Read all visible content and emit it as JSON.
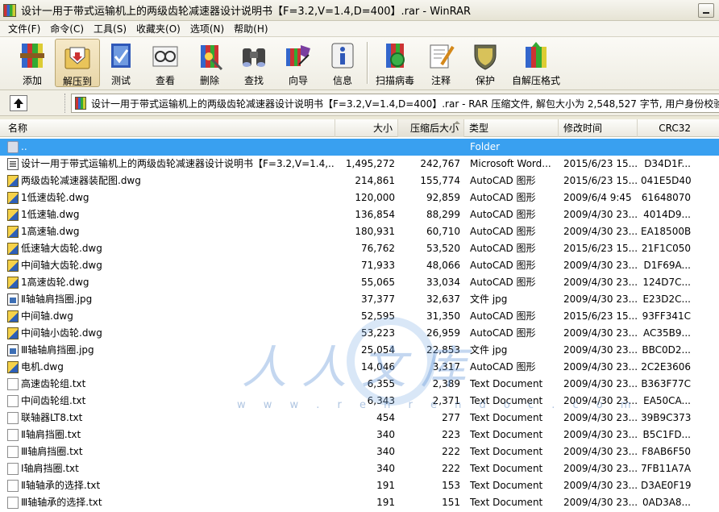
{
  "window": {
    "title": "设计一用于带式运输机上的两级齿轮减速器设计说明书【F=3.2,V=1.4,D=400】.rar - WinRAR"
  },
  "menu": [
    "文件(F)",
    "命令(C)",
    "工具(S)",
    "收藏夹(O)",
    "选项(N)",
    "帮助(H)"
  ],
  "toolbar": {
    "buttons": [
      {
        "label": "添加",
        "icon": "add-archive-icon"
      },
      {
        "label": "解压到",
        "icon": "extract-to-icon"
      },
      {
        "label": "测试",
        "icon": "test-icon"
      },
      {
        "label": "查看",
        "icon": "view-icon"
      },
      {
        "label": "删除",
        "icon": "delete-icon"
      },
      {
        "label": "查找",
        "icon": "find-binoculars-icon"
      },
      {
        "label": "向导",
        "icon": "wizard-icon"
      },
      {
        "label": "信息",
        "icon": "info-icon"
      },
      {
        "label": "扫描病毒",
        "icon": "virus-scan-icon"
      },
      {
        "label": "注释",
        "icon": "comment-icon"
      },
      {
        "label": "保护",
        "icon": "protect-shield-icon"
      },
      {
        "label": "自解压格式",
        "icon": "sfx-icon"
      }
    ]
  },
  "address": {
    "text": "设计一用于带式运输机上的两级齿轮减速器设计说明书【F=3.2,V=1.4,D=400】.rar - RAR 压缩文件, 解包大小为 2,548,527 字节, 用户身份校验信"
  },
  "columns": {
    "name": "名称",
    "size": "大小",
    "packed": "压缩后大小",
    "type": "类型",
    "modified": "修改时间",
    "crc": "CRC32"
  },
  "files": [
    {
      "name": "..",
      "size": "",
      "packed": "",
      "type": "Folder",
      "modified": "",
      "crc": "",
      "icon": "folder"
    },
    {
      "name": "设计一用于带式运输机上的两级齿轮减速器设计说明书【F=3.2,V=1.4,...",
      "size": "1,495,272",
      "packed": "242,767",
      "type": "Microsoft Word...",
      "modified": "2015/6/23 15...",
      "crc": "D34D1F...",
      "icon": "word"
    },
    {
      "name": "两级齿轮减速器装配图.dwg",
      "size": "214,861",
      "packed": "155,774",
      "type": "AutoCAD 图形",
      "modified": "2015/6/23 15...",
      "crc": "041E5D40",
      "icon": "dwg"
    },
    {
      "name": "1低速齿轮.dwg",
      "size": "120,000",
      "packed": "92,859",
      "type": "AutoCAD 图形",
      "modified": "2009/6/4 9:45",
      "crc": "61648070",
      "icon": "dwg"
    },
    {
      "name": "1低速轴.dwg",
      "size": "136,854",
      "packed": "88,299",
      "type": "AutoCAD 图形",
      "modified": "2009/4/30 23...",
      "crc": "4014D9...",
      "icon": "dwg"
    },
    {
      "name": "1高速轴.dwg",
      "size": "180,931",
      "packed": "60,710",
      "type": "AutoCAD 图形",
      "modified": "2009/4/30 23...",
      "crc": "EA18500B",
      "icon": "dwg"
    },
    {
      "name": "低速轴大齿轮.dwg",
      "size": "76,762",
      "packed": "53,520",
      "type": "AutoCAD 图形",
      "modified": "2015/6/23 15...",
      "crc": "21F1C050",
      "icon": "dwg"
    },
    {
      "name": "中间轴大齿轮.dwg",
      "size": "71,933",
      "packed": "48,066",
      "type": "AutoCAD 图形",
      "modified": "2009/4/30 23...",
      "crc": "D1F69A...",
      "icon": "dwg"
    },
    {
      "name": "1高速齿轮.dwg",
      "size": "55,065",
      "packed": "33,034",
      "type": "AutoCAD 图形",
      "modified": "2009/4/30 23...",
      "crc": "124D7C...",
      "icon": "dwg"
    },
    {
      "name": "Ⅱ轴轴肩挡圈.jpg",
      "size": "37,377",
      "packed": "32,637",
      "type": "文件 jpg",
      "modified": "2009/4/30 23...",
      "crc": "E23D2C...",
      "icon": "jpg"
    },
    {
      "name": "中间轴.dwg",
      "size": "52,595",
      "packed": "31,350",
      "type": "AutoCAD 图形",
      "modified": "2015/6/23 15...",
      "crc": "93FF341C",
      "icon": "dwg"
    },
    {
      "name": "中间轴小齿轮.dwg",
      "size": "53,223",
      "packed": "26,959",
      "type": "AutoCAD 图形",
      "modified": "2009/4/30 23...",
      "crc": "AC35B9...",
      "icon": "dwg"
    },
    {
      "name": "Ⅲ轴轴肩挡圈.jpg",
      "size": "25,054",
      "packed": "22,853",
      "type": "文件 jpg",
      "modified": "2009/4/30 23...",
      "crc": "BBC0D2...",
      "icon": "jpg"
    },
    {
      "name": "电机.dwg",
      "size": "14,046",
      "packed": "3,317",
      "type": "AutoCAD 图形",
      "modified": "2009/4/30 23...",
      "crc": "2C2E3606",
      "icon": "dwg"
    },
    {
      "name": "高速齿轮组.txt",
      "size": "6,355",
      "packed": "2,389",
      "type": "Text Document",
      "modified": "2009/4/30 23...",
      "crc": "B363F77C",
      "icon": "txt"
    },
    {
      "name": "中间齿轮组.txt",
      "size": "6,343",
      "packed": "2,371",
      "type": "Text Document",
      "modified": "2009/4/30 23...",
      "crc": "EA50CA...",
      "icon": "txt"
    },
    {
      "name": "联轴器LT8.txt",
      "size": "454",
      "packed": "277",
      "type": "Text Document",
      "modified": "2009/4/30 23...",
      "crc": "39B9C373",
      "icon": "txt"
    },
    {
      "name": "Ⅱ轴肩挡圈.txt",
      "size": "340",
      "packed": "223",
      "type": "Text Document",
      "modified": "2009/4/30 23...",
      "crc": "B5C1FD...",
      "icon": "txt"
    },
    {
      "name": "Ⅲ轴肩挡圈.txt",
      "size": "340",
      "packed": "222",
      "type": "Text Document",
      "modified": "2009/4/30 23...",
      "crc": "F8AB6F50",
      "icon": "txt"
    },
    {
      "name": "Ⅰ轴肩挡圈.txt",
      "size": "340",
      "packed": "222",
      "type": "Text Document",
      "modified": "2009/4/30 23...",
      "crc": "7FB11A7A",
      "icon": "txt"
    },
    {
      "name": "Ⅱ轴轴承的选择.txt",
      "size": "191",
      "packed": "153",
      "type": "Text Document",
      "modified": "2009/4/30 23...",
      "crc": "D3AE0F19",
      "icon": "txt"
    },
    {
      "name": "Ⅲ轴轴承的选择.txt",
      "size": "191",
      "packed": "151",
      "type": "Text Document",
      "modified": "2009/4/30 23...",
      "crc": "0AD3A8...",
      "icon": "txt"
    }
  ],
  "watermark": {
    "text": "人人文库",
    "url": "w w w . r e n r e n d o c . c o m"
  }
}
